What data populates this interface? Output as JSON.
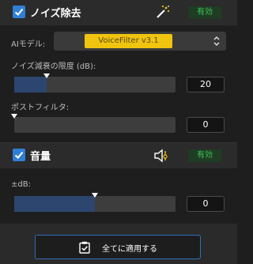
{
  "noise": {
    "title": "ノイズ除去",
    "status": "有効",
    "ai_model_label": "AIモデル:",
    "ai_model_value": "VoiceFilter v3.1",
    "limit_label": "ノイズ減衰の限度 (dB):",
    "limit_value": "20",
    "limit_fraction": 0.2,
    "post_filter_label": "ポストフィルタ:",
    "post_filter_value": "0",
    "post_filter_fraction": 0.0,
    "enabled": true
  },
  "volume": {
    "title": "音量",
    "status": "有効",
    "db_label": "±dB:",
    "db_value": "0",
    "db_fraction": 0.5,
    "enabled": true
  },
  "footer": {
    "apply_label": "全てに適用する"
  },
  "colors": {
    "accent": "#2f7fd6",
    "status_green": "#3fc35a",
    "highlight_yellow": "#f1c40f",
    "slider_fill": "#2d4670"
  },
  "icons": {
    "noise_header": "magic-wand-icon",
    "volume_header": "speaker-icon",
    "apply": "clipboard-check-icon",
    "select_chevron": "chevron-updown-icon",
    "checkbox": "checkmark-icon"
  }
}
